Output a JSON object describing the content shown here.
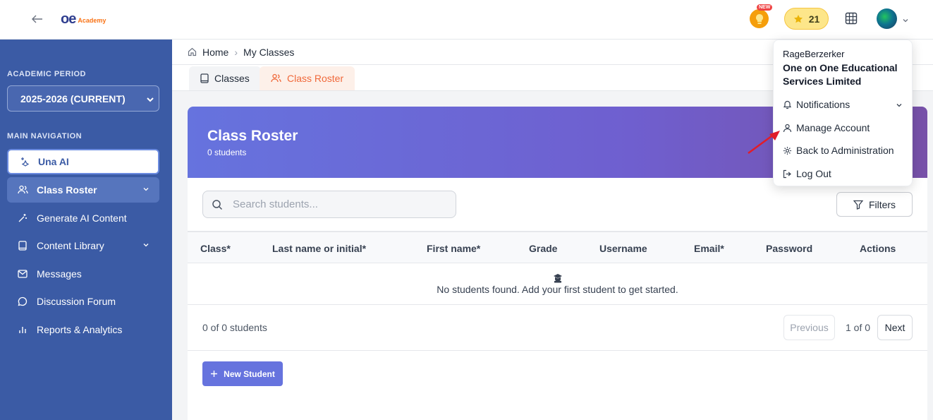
{
  "topbar": {
    "logo_mark": "oe",
    "logo_text": "Academy",
    "new_badge": "NEW",
    "points": "21"
  },
  "sidebar": {
    "academic_period_label": "ACADEMIC PERIOD",
    "period_value": "2025-2026 (CURRENT)",
    "main_nav_label": "MAIN NAVIGATION",
    "items": [
      {
        "label": "Una AI",
        "icon": "sparkle-icon"
      },
      {
        "label": "Class Roster",
        "icon": "users-icon"
      },
      {
        "label": "Generate AI Content",
        "icon": "magic-wand-icon"
      },
      {
        "label": "Content Library",
        "icon": "book-icon"
      },
      {
        "label": "Messages",
        "icon": "mail-icon"
      },
      {
        "label": "Discussion Forum",
        "icon": "chat-icon"
      },
      {
        "label": "Reports & Analytics",
        "icon": "bar-chart-icon"
      }
    ]
  },
  "breadcrumb": {
    "home": "Home",
    "separator": "›",
    "current": "My Classes"
  },
  "tabs": {
    "classes": "Classes",
    "roster": "Class Roster"
  },
  "hero": {
    "title": "Class Roster",
    "subtitle": "0 students"
  },
  "search": {
    "placeholder": "Search students..."
  },
  "filters_label": "Filters",
  "table": {
    "headers": [
      "Class*",
      "Last name or initial*",
      "First name*",
      "Grade",
      "Username",
      "Email*",
      "Password",
      "Actions"
    ],
    "empty_text": "No students found. Add your first student to get started."
  },
  "pager": {
    "count": "0 of 0 students",
    "previous": "Previous",
    "info": "1 of 0",
    "next": "Next"
  },
  "new_student_label": "New Student",
  "dropdown": {
    "username": "RageBerzerker",
    "org": "One on One Educational Services Limited",
    "items": [
      "Notifications",
      "Manage Account",
      "Back to Administration",
      "Log Out"
    ]
  },
  "colors": {
    "sidebar": "#3b5ba5",
    "accent": "#6673de",
    "orange": "#f0693b"
  }
}
